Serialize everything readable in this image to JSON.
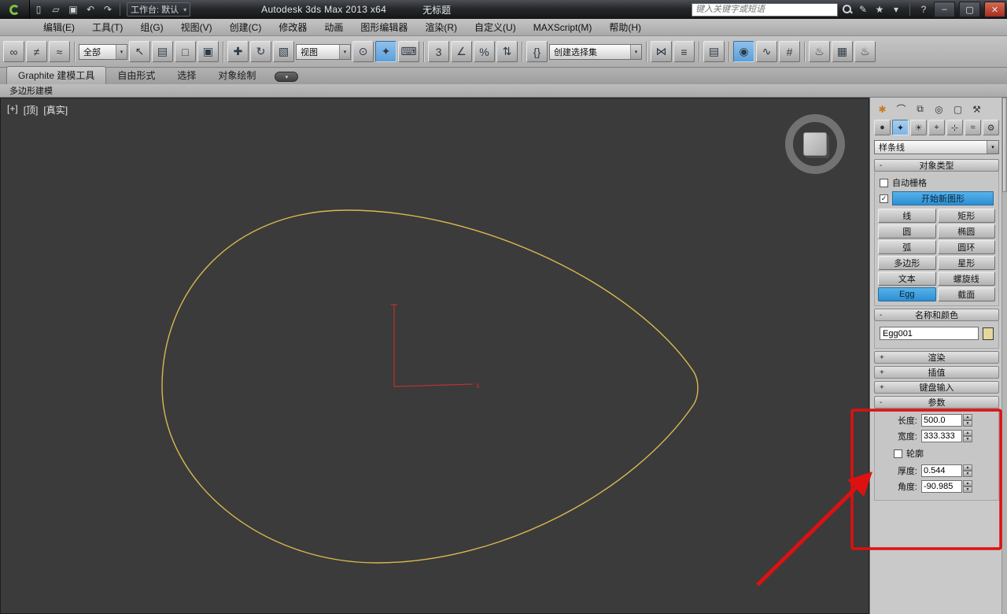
{
  "titlebar": {
    "workspace": "工作台: 默认",
    "title": "Autodesk 3ds Max  2013 x64",
    "doc": "无标题",
    "search_placeholder": "键入关键字或短语"
  },
  "icons": {
    "new": "▯",
    "open": "▱",
    "save": "▣",
    "undo": "↶",
    "redo": "↷",
    "dd_arrow": "▾",
    "pen": "✎",
    "star": "★",
    "down": "▾",
    "info": "ⓘ",
    "help": "?",
    "min": "–",
    "restore": "▢",
    "close": "✕",
    "link": "∞",
    "unlink": "≠",
    "bind": "≈",
    "select": "↖",
    "select_by_name": "▤",
    "rect_region": "□",
    "window_crossing": "▣",
    "move": "✚",
    "rotate": "↻",
    "scale": "▧",
    "pivot": "⊙",
    "manipulate": "✦",
    "keyboard": "⌨",
    "snap3": "3",
    "snap_angle": "∠",
    "snap_percent": "%",
    "snap_spinner": "⇅",
    "named_sets": "{}",
    "mirror": "⋈",
    "align": "≡",
    "layers": "▤",
    "curve_editor": "∿",
    "schematic": "#",
    "material": "◉",
    "render_setup": "♨",
    "rendered_frame": "▦",
    "render": "♨",
    "check": "✓",
    "cp_create": "✱",
    "cp_modify": "⌒",
    "cp_hierarchy": "⧉",
    "cp_motion": "◎",
    "cp_display": "▢",
    "cp_utilities": "⚒",
    "cat_geometry": "●",
    "cat_shapes": "✦",
    "cat_lights": "☀",
    "cat_cameras": "⌖",
    "cat_helpers": "⊹",
    "cat_spacewarps": "≈",
    "cat_systems": "⚙",
    "pill": "▾"
  },
  "menubar": {
    "items": [
      "编辑(E)",
      "工具(T)",
      "组(G)",
      "视图(V)",
      "创建(C)",
      "修改器",
      "动画",
      "图形编辑器",
      "渲染(R)",
      "自定义(U)",
      "MAXScript(M)",
      "帮助(H)"
    ]
  },
  "toolbar": {
    "filter": "全部",
    "coord": "视图",
    "selset": "创建选择集"
  },
  "ribbon": {
    "tab_graphite": "Graphite 建模工具",
    "tab_freeform": "自由形式",
    "tab_selection": "选择",
    "tab_object_paint": "对象绘制",
    "subtab": "多边形建模"
  },
  "viewport": {
    "label_plus": "[+]",
    "label_view": "[顶]",
    "label_shading": "[真实]",
    "axis_x": "x"
  },
  "panel": {
    "category": "样条线",
    "object_type": {
      "sign": "-",
      "title": "对象类型",
      "autogrid": "自动栅格",
      "start_new_shape": "开始新图形",
      "buttons": [
        "线",
        "矩形",
        "圆",
        "椭圆",
        "弧",
        "圆环",
        "多边形",
        "星形",
        "文本",
        "螺旋线",
        "Egg",
        "截面"
      ]
    },
    "name_color": {
      "sign": "-",
      "title": "名称和颜色",
      "name": "Egg001"
    },
    "rendering": {
      "sign": "+",
      "title": "渲染"
    },
    "interpolation": {
      "sign": "+",
      "title": "插值"
    },
    "keyboard": {
      "sign": "+",
      "title": "键盘输入"
    },
    "parameters": {
      "sign": "-",
      "title": "参数",
      "length_label": "长度:",
      "length": "500.0",
      "width_label": "宽度:",
      "width": "333.333",
      "outline": "轮廓",
      "thickness_label": "厚度:",
      "thickness": "0.544",
      "angle_label": "角度:",
      "angle": "-90.985"
    }
  }
}
